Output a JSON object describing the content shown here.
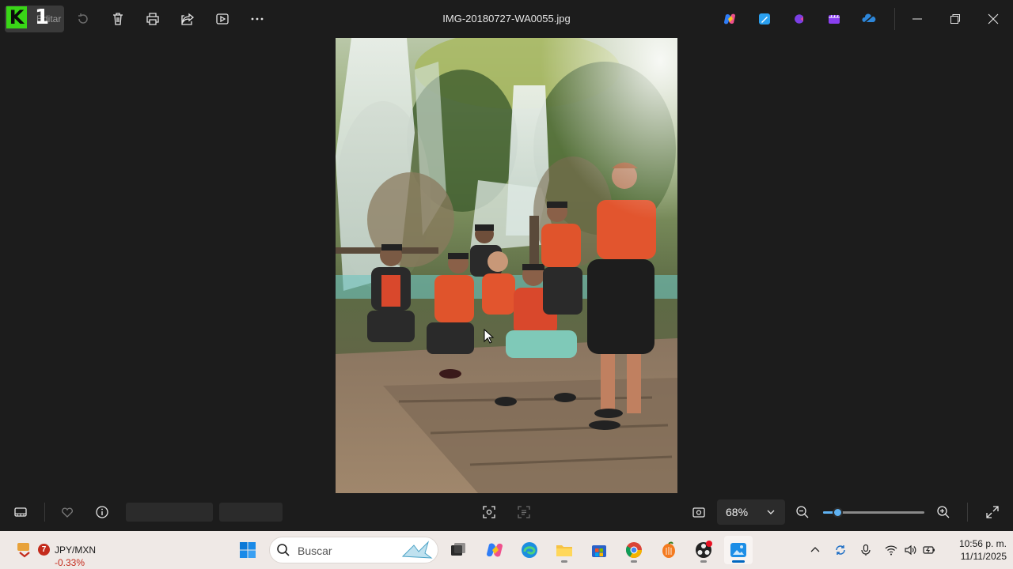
{
  "titlebar": {
    "edit_label": "Editar",
    "overlay_badge": "1",
    "file_name": "IMG-20180727-WA0055.jpg"
  },
  "bottombar": {
    "zoom_level": "68%",
    "zoom_fraction": 0.14
  },
  "taskbar": {
    "ticker_name": "JPY/MXN",
    "ticker_change": "-0.33%",
    "notification_count": "7",
    "search_placeholder": "Buscar",
    "clock_time": "10:56 p. m.",
    "clock_date": "11/11/2025"
  },
  "colors": {
    "background": "#1c1c1c",
    "accent": "#5fb2f2",
    "taskbar": "#efe9e6",
    "logo_green": "#39d617"
  },
  "icons": [
    "edit-icon",
    "rotate-icon",
    "delete-icon",
    "print-icon",
    "share-icon",
    "slideshow-icon",
    "more-icon",
    "copilot-icon",
    "designer-icon",
    "clipchamp-icon",
    "video-editor-icon",
    "onedrive-icon",
    "minimize-icon",
    "restore-icon",
    "close-icon",
    "filmstrip-icon",
    "favorite-icon",
    "info-icon",
    "visual-search-icon",
    "text-scan-icon",
    "actual-size-icon",
    "zoom-out-icon",
    "zoom-in-icon",
    "fullscreen-icon"
  ]
}
